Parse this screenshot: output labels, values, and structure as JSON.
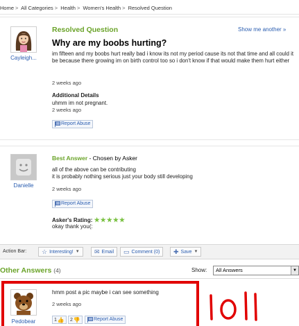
{
  "breadcrumb": [
    "Home",
    "All Categories",
    "Health",
    "Women's Health",
    "Resolved Question"
  ],
  "question": {
    "heading": "Resolved Question",
    "show_more": "Show me another »",
    "asker": "Cayleigh...",
    "title": "Why are my boobs hurting?",
    "body": "im fifteen and my boobs hurt really bad i know its not my period cause its not that time and all could it be because there growing im on birth control too so i don't know if that would make them hurt either",
    "time": "2 weeks ago",
    "additional_label": "Additional Details",
    "additional_text": "uhmm im not pregnant.",
    "additional_time": "2 weeks ago",
    "report": "Report Abuse"
  },
  "best_answer": {
    "label": "Best Answer",
    "chosen": " - Chosen by Asker",
    "user": "Danielle",
    "line1": "all of the above can be contributing",
    "line2": "it is probably nothing serious just your body still developing",
    "time": "2 weeks ago",
    "report": "Report Abuse",
    "rating_label": "Asker's Rating:",
    "stars": "★★★★★",
    "rating_comment": "okay thank you(:"
  },
  "action_bar": {
    "label": "Action Bar:",
    "interesting": "Interesting!",
    "email": "Email",
    "comment": "Comment (0)",
    "save": "Save"
  },
  "other_answers": {
    "heading": "Other Answers",
    "count": "(4)",
    "show_label": "Show:",
    "show_value": "All Answers",
    "answers": [
      {
        "user": "Pedobear",
        "text": "hmm post a pic maybe i can see something",
        "time": "2 weeks ago",
        "thumbs_up": "1",
        "thumbs_down": "2",
        "report": "Report Abuse"
      }
    ]
  },
  "annotation": {
    "text": "lol!",
    "color": "#e10000"
  },
  "colors": {
    "accent_green": "#6aa329",
    "link_blue": "#2a5db0",
    "star_green": "#7ac142"
  }
}
